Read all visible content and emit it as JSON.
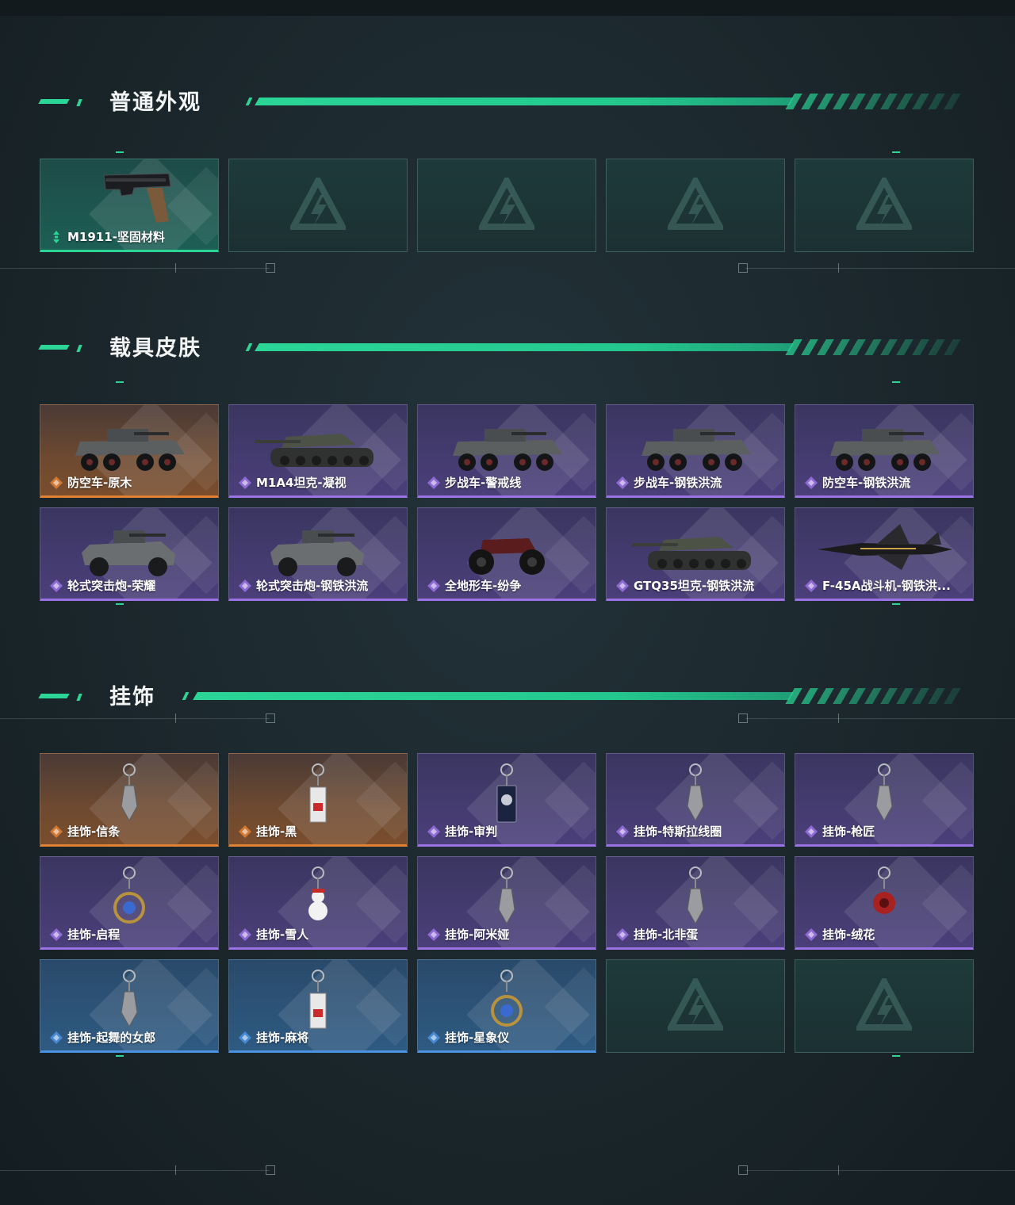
{
  "sections": [
    {
      "title": "普通外观",
      "items": [
        {
          "label": "M1911-坚固材料",
          "rarity": "green",
          "icon": "pistol-icon"
        },
        {
          "label": "",
          "rarity": "empty",
          "icon": "placeholder-logo-icon"
        },
        {
          "label": "",
          "rarity": "empty",
          "icon": "placeholder-logo-icon"
        },
        {
          "label": "",
          "rarity": "empty",
          "icon": "placeholder-logo-icon"
        },
        {
          "label": "",
          "rarity": "empty",
          "icon": "placeholder-logo-icon"
        }
      ]
    },
    {
      "title": "载具皮肤",
      "items": [
        {
          "label": "防空车-原木",
          "rarity": "orange",
          "icon": "armored-vehicle-icon"
        },
        {
          "label": "M1A4坦克-凝视",
          "rarity": "purple",
          "icon": "tank-icon"
        },
        {
          "label": "步战车-警戒线",
          "rarity": "purple",
          "icon": "armored-vehicle-icon"
        },
        {
          "label": "步战车-钢铁洪流",
          "rarity": "purple",
          "icon": "armored-vehicle-icon"
        },
        {
          "label": "防空车-钢铁洪流",
          "rarity": "purple",
          "icon": "armored-vehicle-icon"
        },
        {
          "label": "轮式突击炮-荣耀",
          "rarity": "purple",
          "icon": "light-vehicle-icon"
        },
        {
          "label": "轮式突击炮-钢铁洪流",
          "rarity": "purple",
          "icon": "light-vehicle-icon"
        },
        {
          "label": "全地形车-纷争",
          "rarity": "purple",
          "icon": "atv-icon"
        },
        {
          "label": "GTQ35坦克-钢铁洪流",
          "rarity": "purple",
          "icon": "tank-icon"
        },
        {
          "label": "F-45A战斗机-钢铁洪...",
          "rarity": "purple",
          "icon": "jet-icon"
        }
      ]
    },
    {
      "title": "挂饰",
      "items": [
        {
          "label": "挂饰-信条",
          "rarity": "orange",
          "icon": "charm-icon"
        },
        {
          "label": "挂饰-黑",
          "rarity": "orange",
          "icon": "charm-tag-icon"
        },
        {
          "label": "挂饰-审判",
          "rarity": "purple",
          "icon": "charm-card-icon"
        },
        {
          "label": "挂饰-特斯拉线圈",
          "rarity": "purple",
          "icon": "charm-icon"
        },
        {
          "label": "挂饰-枪匠",
          "rarity": "purple",
          "icon": "charm-icon"
        },
        {
          "label": "挂饰-启程",
          "rarity": "purple",
          "icon": "charm-ring-icon"
        },
        {
          "label": "挂饰-雪人",
          "rarity": "purple",
          "icon": "charm-snowman-icon"
        },
        {
          "label": "挂饰-阿米娅",
          "rarity": "purple",
          "icon": "charm-icon"
        },
        {
          "label": "挂饰-北非蛋",
          "rarity": "purple",
          "icon": "charm-icon"
        },
        {
          "label": "挂饰-绒花",
          "rarity": "purple",
          "icon": "charm-flower-icon"
        },
        {
          "label": "挂饰-起舞的女郎",
          "rarity": "blue",
          "icon": "charm-icon"
        },
        {
          "label": "挂饰-麻将",
          "rarity": "blue",
          "icon": "charm-tag-icon"
        },
        {
          "label": "挂饰-星象仪",
          "rarity": "blue",
          "icon": "charm-ring-icon"
        },
        {
          "label": "",
          "rarity": "empty",
          "icon": "placeholder-logo-icon"
        },
        {
          "label": "",
          "rarity": "empty",
          "icon": "placeholder-logo-icon"
        }
      ]
    }
  ],
  "colors": {
    "accent": "#2ad596",
    "green": "#2ad596",
    "orange": "#e08033",
    "purple": "#9a72e4",
    "blue": "#4a92e0"
  }
}
